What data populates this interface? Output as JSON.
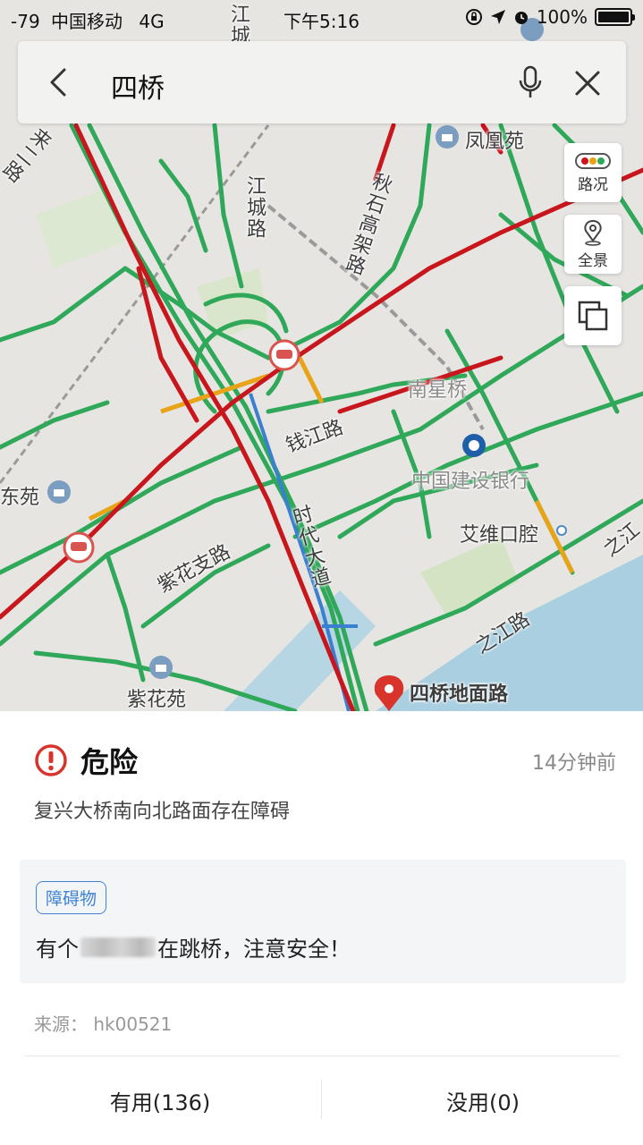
{
  "status_bar": {
    "signal": "-79",
    "carrier": "中国移动",
    "network": "4G",
    "time": "下午5:16",
    "battery": "100%"
  },
  "search": {
    "query": "四桥"
  },
  "map_controls": {
    "traffic_label": "路况",
    "overview_label": "全景"
  },
  "map": {
    "labels": {
      "fenghuangyuan": "凤凰苑",
      "jiangcheng_road": "江城路",
      "qiushi_expressway": "秋石高架路",
      "nanxingqiao": "南星桥",
      "qianjiang_road": "钱江路",
      "ccb": "中国建设银行",
      "aiwei_dental": "艾维口腔",
      "dongyuan": "东苑",
      "zihua_branch_road": "紫花支路",
      "shidai_avenue": "时代大道",
      "zhijiang_road": "之江路",
      "zhijiang_road_2": "之江",
      "zihuayuan": "紫花苑",
      "sigiao_ground_road": "四桥地面路",
      "top_left_road": "来二路",
      "top_road": "江城"
    },
    "colors": {
      "smooth": "#2fa85a",
      "congested": "#c8161d",
      "slow": "#e8a317",
      "water": "#a9cfe0",
      "park": "#d4e3c3"
    }
  },
  "panel": {
    "title": "危险",
    "time_ago": "14分钟前",
    "description": "复兴大桥南向北路面存在障碍",
    "tag": "障碍物",
    "message_before": "有个",
    "message_after": "在跳桥，注意安全！",
    "source": "来源：  hk00521",
    "useful_label": "有用(136)",
    "useless_label": "没用(0)"
  }
}
